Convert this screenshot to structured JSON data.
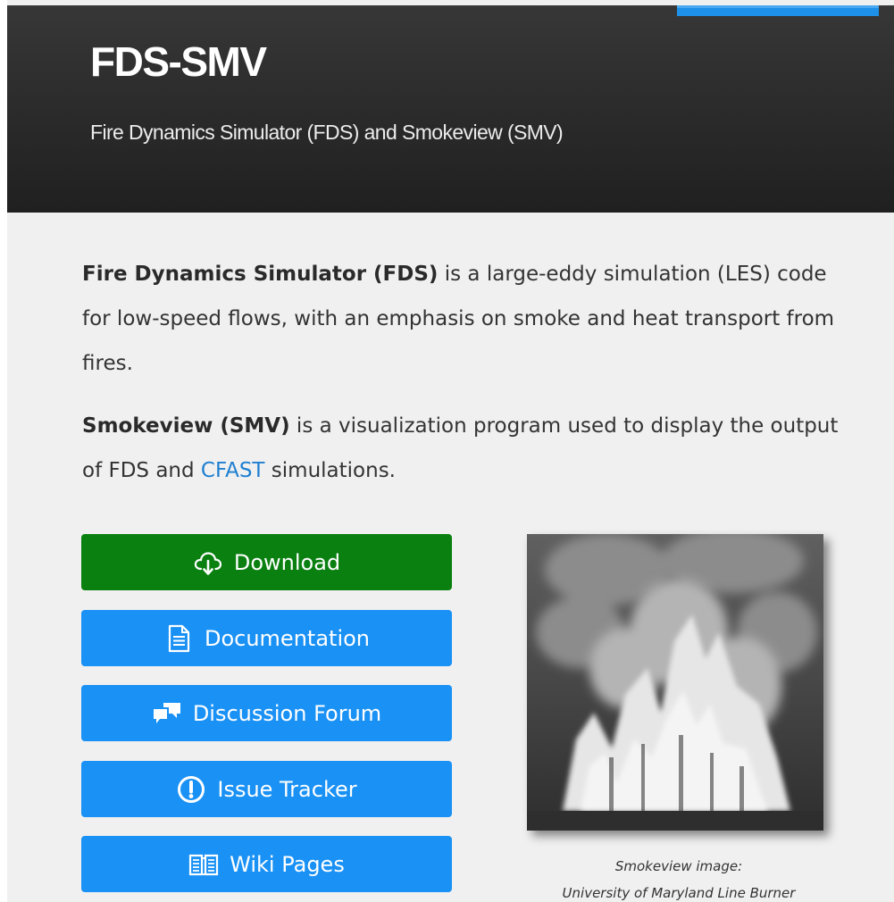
{
  "header": {
    "title": "FDS-SMV",
    "subtitle": "Fire Dynamics Simulator (FDS) and Smokeview (SMV)"
  },
  "intro": {
    "fds_term": "Fire Dynamics Simulator (FDS)",
    "fds_text": " is a large-eddy simulation (LES) code for low-speed flows, with an emphasis on smoke and heat transport from fires.",
    "smv_term": "Smokeview (SMV)",
    "smv_text_before": " is a visualization program used to display the output of FDS and ",
    "cfast_link": "CFAST",
    "smv_text_after": " simulations."
  },
  "buttons": [
    {
      "label": "Download",
      "icon": "cloud-download-icon",
      "color": "#0a8010"
    },
    {
      "label": "Documentation",
      "icon": "document-icon",
      "color": "#1a91f5"
    },
    {
      "label": "Discussion Forum",
      "icon": "chat-bubbles-icon",
      "color": "#1a91f5"
    },
    {
      "label": "Issue Tracker",
      "icon": "exclamation-circle-icon",
      "color": "#1a91f5"
    },
    {
      "label": "Wiki Pages",
      "icon": "open-book-icon",
      "color": "#1a91f5"
    }
  ],
  "figure": {
    "caption_line1": "Smokeview image:",
    "caption_line2": "University of Maryland Line Burner"
  },
  "colors": {
    "header_bg": "#2a2a2a",
    "page_bg": "#f0f0f0",
    "link": "#1e7fd1",
    "accent_tab": "#1e90e8"
  }
}
